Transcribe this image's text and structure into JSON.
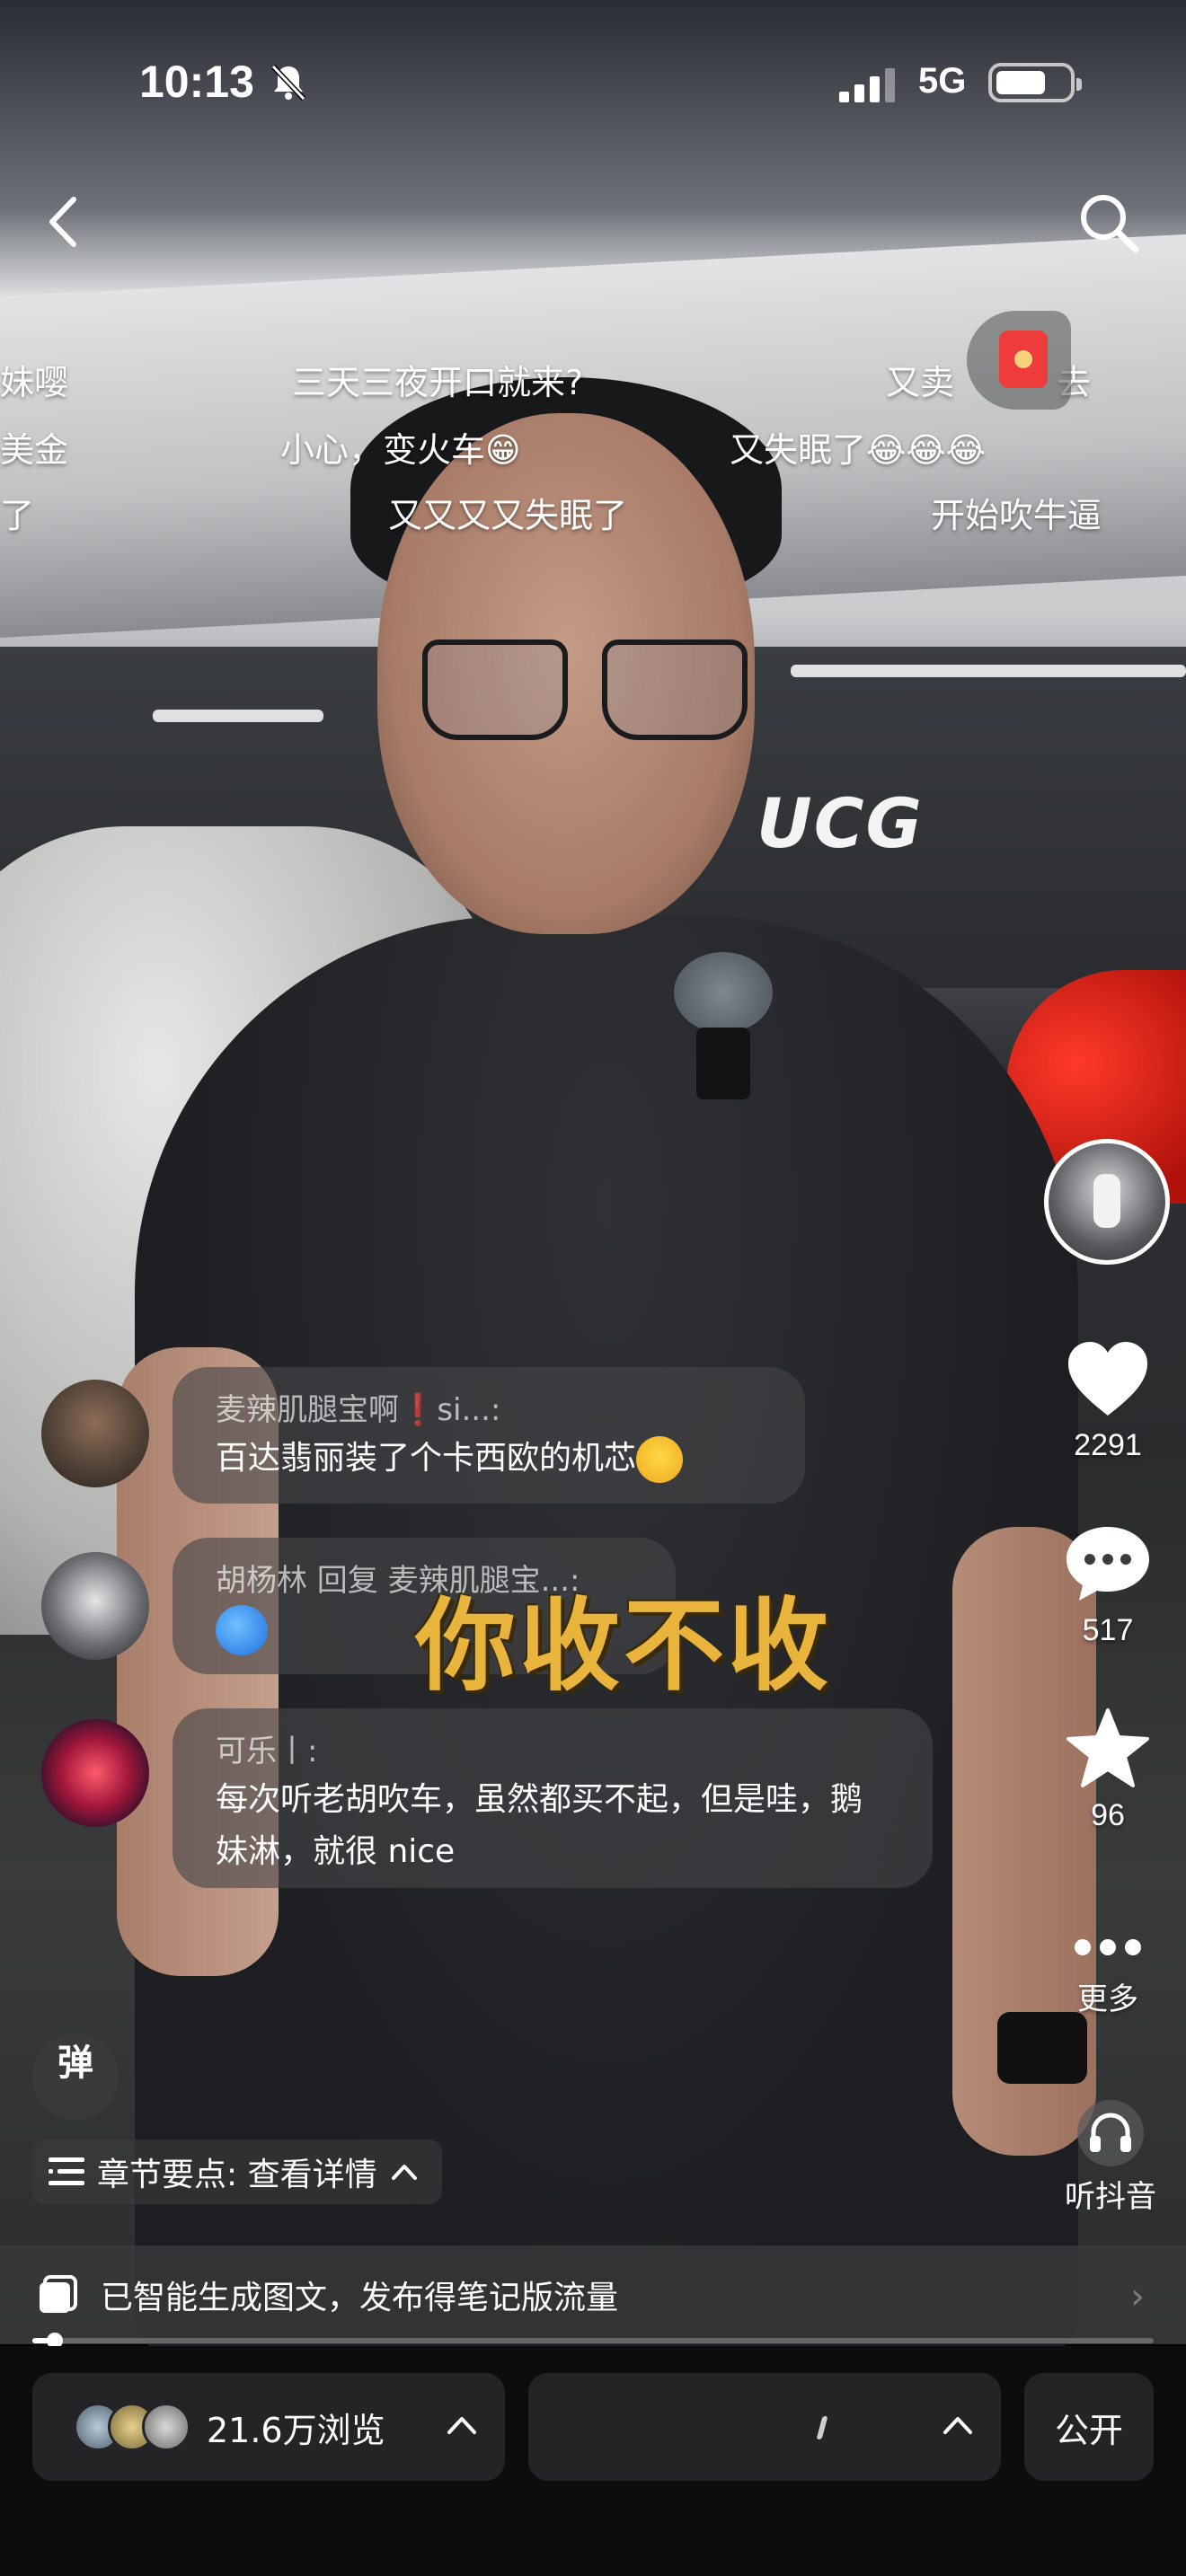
{
  "status_bar": {
    "time": "10:13",
    "network": "5G"
  },
  "danmaku": [
    {
      "text": "妹嘤"
    },
    {
      "text": "三天三夜开口就来?"
    },
    {
      "text": "又卖"
    },
    {
      "text": "去"
    },
    {
      "text": "美金"
    },
    {
      "text": "小心，变火车😁"
    },
    {
      "text": "又失眠了😂😂😂"
    },
    {
      "text": "了"
    },
    {
      "text": "又又又又失眠了"
    },
    {
      "text": "开始吹牛逼"
    }
  ],
  "video": {
    "subtitle": "你收不收",
    "sign_text": "UCG"
  },
  "right_rail": {
    "likes": "2291",
    "comments": "517",
    "favorites": "96",
    "more_label": "更多"
  },
  "comments": [
    {
      "author": "麦辣肌腿宝啊❗si...:",
      "text": "百达翡丽装了个卡西欧的机芯"
    },
    {
      "author": "胡杨林 回复 麦辣肌腿宝...:",
      "text": ""
    },
    {
      "author": "可乐丨:",
      "text": "每次听老胡吹车，虽然都买不起，但是哇，鹅妹淋，就很 nice"
    }
  ],
  "controls": {
    "danmaku_toggle": "弹",
    "chapter_label": "章节要点: 查看详情",
    "listen_label": "听抖音"
  },
  "notice": {
    "text": "已智能生成图文，发布得笔记版流量"
  },
  "progress": {
    "played_fraction": 0.02
  },
  "bottom_bar": {
    "views": "21.6万浏览",
    "public_label": "公开"
  }
}
